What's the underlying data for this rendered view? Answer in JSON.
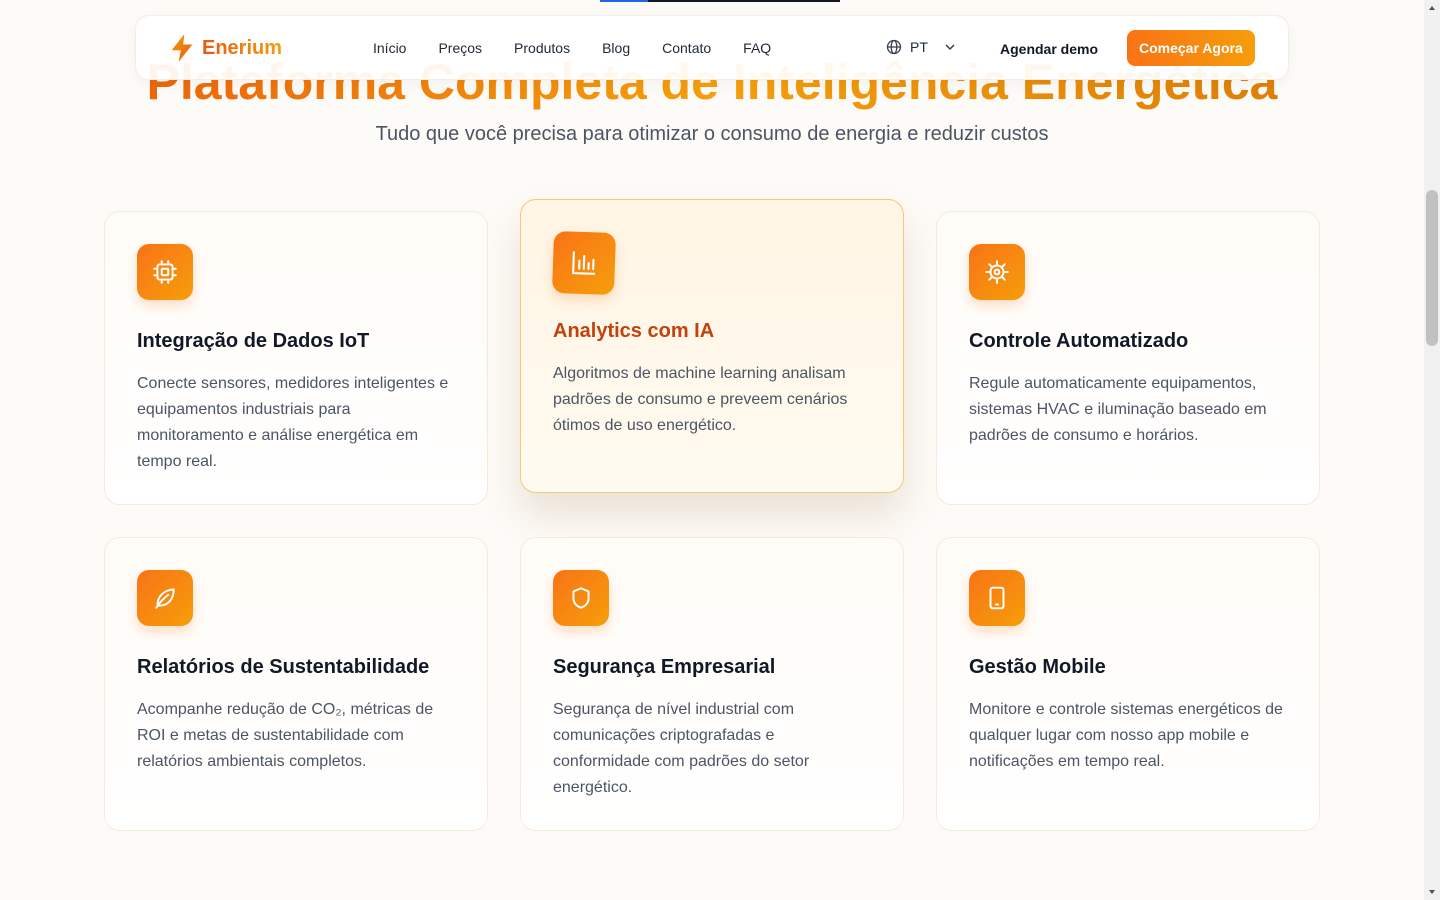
{
  "brand": {
    "name": "Enerium"
  },
  "nav": {
    "links": [
      "Início",
      "Preços",
      "Produtos",
      "Blog",
      "Contato",
      "FAQ"
    ],
    "language": "PT",
    "demo_label": "Agendar demo",
    "cta_label": "Começar Agora"
  },
  "hero": {
    "title": "Plataforma Completa de Inteligência Energética",
    "subtitle": "Tudo que você precisa para otimizar o consumo de energia e reduzir custos"
  },
  "features": [
    {
      "icon": "chip-icon",
      "title": "Integração de Dados IoT",
      "description": "Conecte sensores, medidores inteligentes e equipamentos industriais para monitoramento e análise energética em tempo real."
    },
    {
      "icon": "bar-chart-icon",
      "title": "Analytics com IA",
      "description": "Algoritmos de machine learning analisam padrões de consumo e preveem cenários ótimos de uso energético."
    },
    {
      "icon": "gear-icon",
      "title": "Controle Automatizado",
      "description": "Regule automaticamente equipamentos, sistemas HVAC e iluminação baseado em padrões de consumo e horários."
    },
    {
      "icon": "leaf-icon",
      "title": "Relatórios de Sustentabilidade",
      "description": "Acompanhe redução de CO₂, métricas de ROI e metas de sustentabilidade com relatórios ambientais completos."
    },
    {
      "icon": "shield-icon",
      "title": "Segurança Empresarial",
      "description": "Segurança de nível industrial com comunicações criptografadas e conformidade com padrões do setor energético."
    },
    {
      "icon": "smartphone-icon",
      "title": "Gestão Mobile",
      "description": "Monitore e controle sistemas energéticos de qualquer lugar com nosso app mobile e notificações em tempo real."
    }
  ],
  "colors": {
    "accent": "#f97316",
    "accent_secondary": "#f59e0b",
    "featured_title": "#c2410c"
  }
}
